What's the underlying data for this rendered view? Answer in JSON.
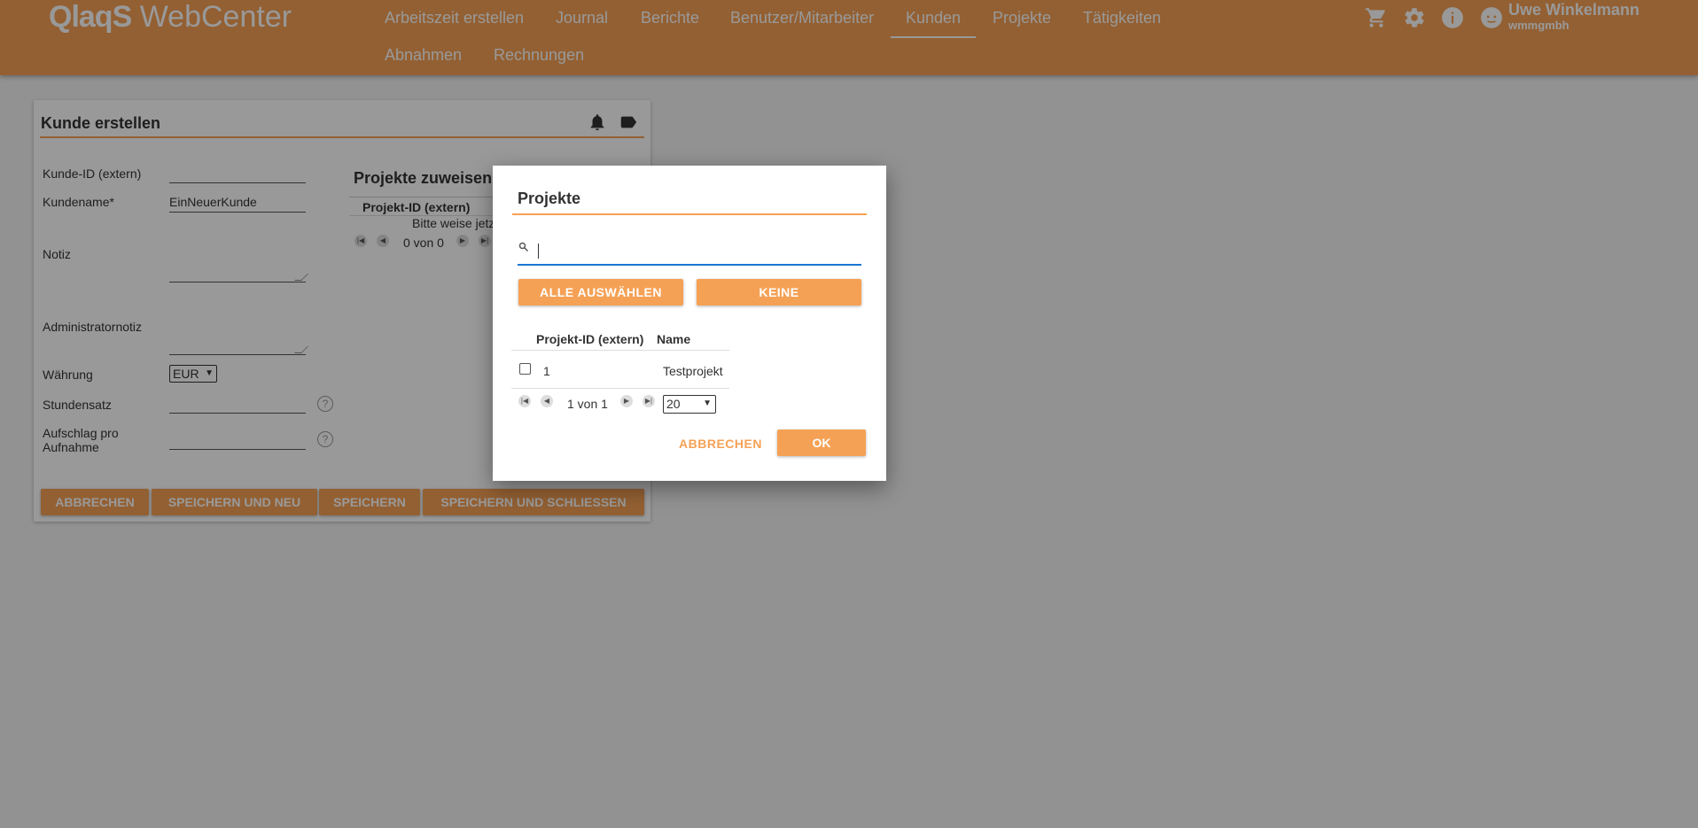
{
  "header": {
    "logo_bold": "QlaqS",
    "logo_light": "WebCenter",
    "nav": [
      {
        "label": "Arbeitszeit erstellen",
        "active": false
      },
      {
        "label": "Journal",
        "active": false
      },
      {
        "label": "Berichte",
        "active": false
      },
      {
        "label": "Benutzer/Mitarbeiter",
        "active": false
      },
      {
        "label": "Kunden",
        "active": true
      },
      {
        "label": "Projekte",
        "active": false
      },
      {
        "label": "Tätigkeiten",
        "active": false
      },
      {
        "label": "Abnahmen",
        "active": false
      },
      {
        "label": "Rechnungen",
        "active": false
      }
    ],
    "icons": [
      "cart-icon",
      "gear-icon",
      "info-icon",
      "user-icon"
    ],
    "user_name": "Uwe Winkelmann",
    "user_company": "wmmgmbh",
    "accent_color": "#f5a155"
  },
  "form": {
    "title": "Kunde erstellen",
    "icons": [
      "bell-icon",
      "tag-icon"
    ],
    "fields": {
      "kunde_id_label": "Kunde-ID (extern)",
      "kunde_id_value": "",
      "kundename_label": "Kundename*",
      "kundename_value": "EinNeuerKunde",
      "notiz_label": "Notiz",
      "admin_notiz_label": "Administratornotiz",
      "waehrung_label": "Währung",
      "waehrung_value": "EUR",
      "stundensatz_label": "Stundensatz",
      "aufschlag_label_line1": "Aufschlag pro",
      "aufschlag_label_line2": "Aufnahme",
      "help": "?"
    },
    "projects": {
      "title": "Projekte zuweisen",
      "column": "Projekt-ID (extern)",
      "empty_text": "Bitte weise jetz",
      "pager": "0 von 0"
    },
    "buttons": {
      "cancel": "ABBRECHEN",
      "save_new": "SPEICHERN UND NEU",
      "save": "SPEICHERN",
      "save_close": "SPEICHERN UND SCHLIESSEN"
    }
  },
  "dialog": {
    "title": "Projekte",
    "search_value": "",
    "select_all": "ALLE AUSWÄHLEN",
    "none": "KEINE",
    "columns": [
      "Projekt-ID (extern)",
      "Name"
    ],
    "rows": [
      {
        "checked": false,
        "id": "1",
        "name": "Testprojekt"
      }
    ],
    "pager": "1 von 1",
    "page_size": "20",
    "cancel": "ABBRECHEN",
    "ok": "OK"
  }
}
